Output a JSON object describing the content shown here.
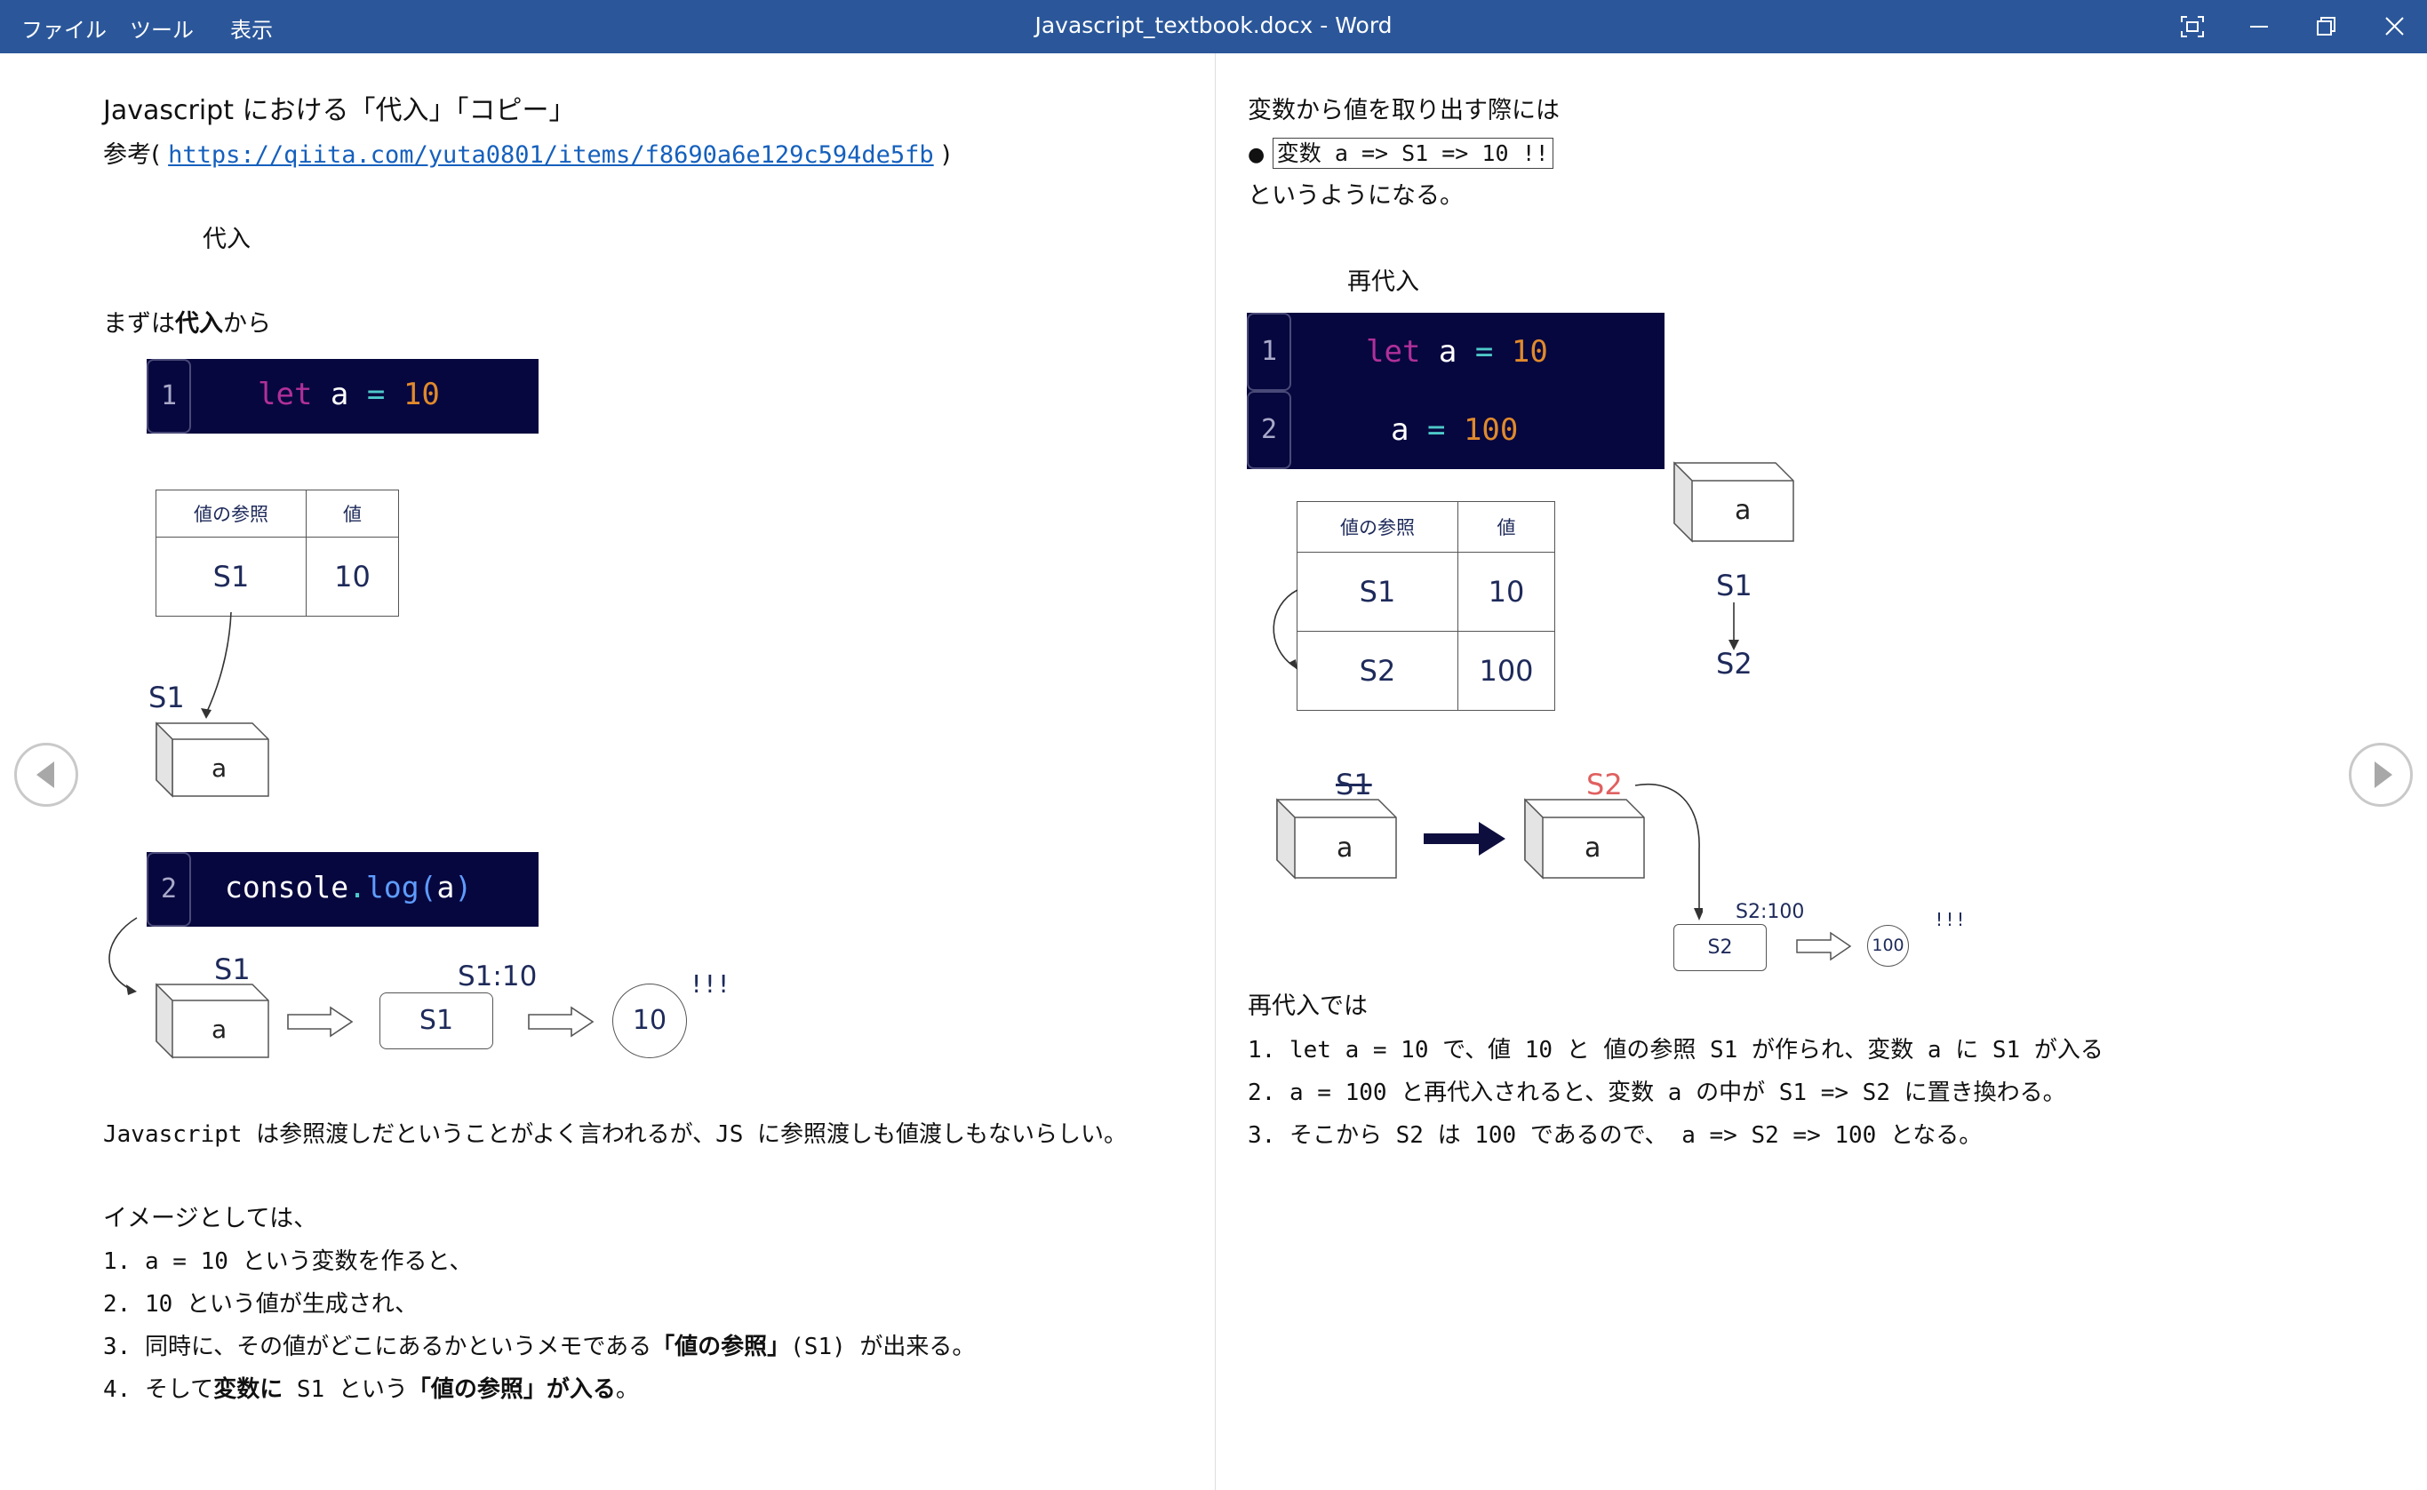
{
  "titlebar": {
    "menu": [
      "ファイル",
      "ツール",
      "表示"
    ],
    "title": "Javascript_textbook.docx - Word",
    "buttons": [
      "focus-mode",
      "minimize",
      "restore",
      "close"
    ]
  },
  "left": {
    "heading": "Javascript における「代入」「コピー」",
    "ref_prefix": "参考(",
    "ref_link": "https://qiita.com/yuta0801/items/f8690a6e129c594de5fb",
    "ref_suffix": ")",
    "section": "代入",
    "intro_prefix": "まずは",
    "intro_bold": "代入",
    "intro_suffix": "から",
    "code1": {
      "line": "1",
      "kw": "let",
      "var": "a",
      "op": "=",
      "num": "10"
    },
    "table": {
      "headers": [
        "値の参照",
        "値"
      ],
      "row": [
        "S1",
        "10"
      ]
    },
    "label_s1_top": "S1",
    "box_a": "a",
    "code2": {
      "line": "2",
      "obj": "console",
      "dot": ".",
      "fn": "log",
      "open": "(",
      "arg": "a",
      "close": ")"
    },
    "flow": {
      "s1_label": "S1",
      "box": "a",
      "ref_box": "S1",
      "ref_label": "S1:10",
      "value": "10",
      "bang": "!!!"
    },
    "p1": "Javascript は参照渡しだということがよく言われるが、JS に参照渡しも値渡しもないらしい。",
    "p2": "イメージとしては、",
    "l1": "1. a = 10 という変数を作ると、",
    "l2": "2. 10 という値が生成され、",
    "l3_a": "3. 同時に、その値がどこにあるかというメモである",
    "l3_b": "「値の参照」",
    "l3_c": "(S1) が出来る。",
    "l4_a": "4. そして",
    "l4_b": "変数に",
    "l4_c": " S1 という",
    "l4_d": "「値の参照」が入る",
    "l4_e": "。"
  },
  "right": {
    "p_top": "変数から値を取り出す際には",
    "bullet_text": "変数 a => S1 => 10 !!",
    "p_after": "というようになる。",
    "section": "再代入",
    "code": [
      {
        "line": "1",
        "kw": "let",
        "var": "a",
        "op": "=",
        "num": "10"
      },
      {
        "line": "2",
        "var": "a",
        "op": "=",
        "num": "100"
      }
    ],
    "table": {
      "headers": [
        "値の参照",
        "値"
      ],
      "rows": [
        [
          "S1",
          "10"
        ],
        [
          "S2",
          "100"
        ]
      ]
    },
    "side": {
      "box": "a",
      "s1": "S1",
      "s2": "S2"
    },
    "flow": {
      "old_label": "S1",
      "new_label": "S2",
      "box_left": "a",
      "box_right": "a",
      "ref_label": "S2:100",
      "ref_box": "S2",
      "value": "100",
      "bang": "!!!"
    },
    "p_summary": "再代入では",
    "s1": "1. let a = 10 で、値 10 と  値の参照 S1  が作られ、変数 a に S1 が入る",
    "s2": "2. a = 100 と再代入されると、変数 a の中が S1 => S2 に置き換わる。",
    "s3": "3. そこから S2 は 100 であるので、 a => S2 => 100 となる。"
  },
  "colors": {
    "titlebar": "#2b579a",
    "code_bg": "#07073f",
    "keyword": "#b0309a",
    "number": "#e08a2c",
    "strike_label": "#e06060"
  }
}
